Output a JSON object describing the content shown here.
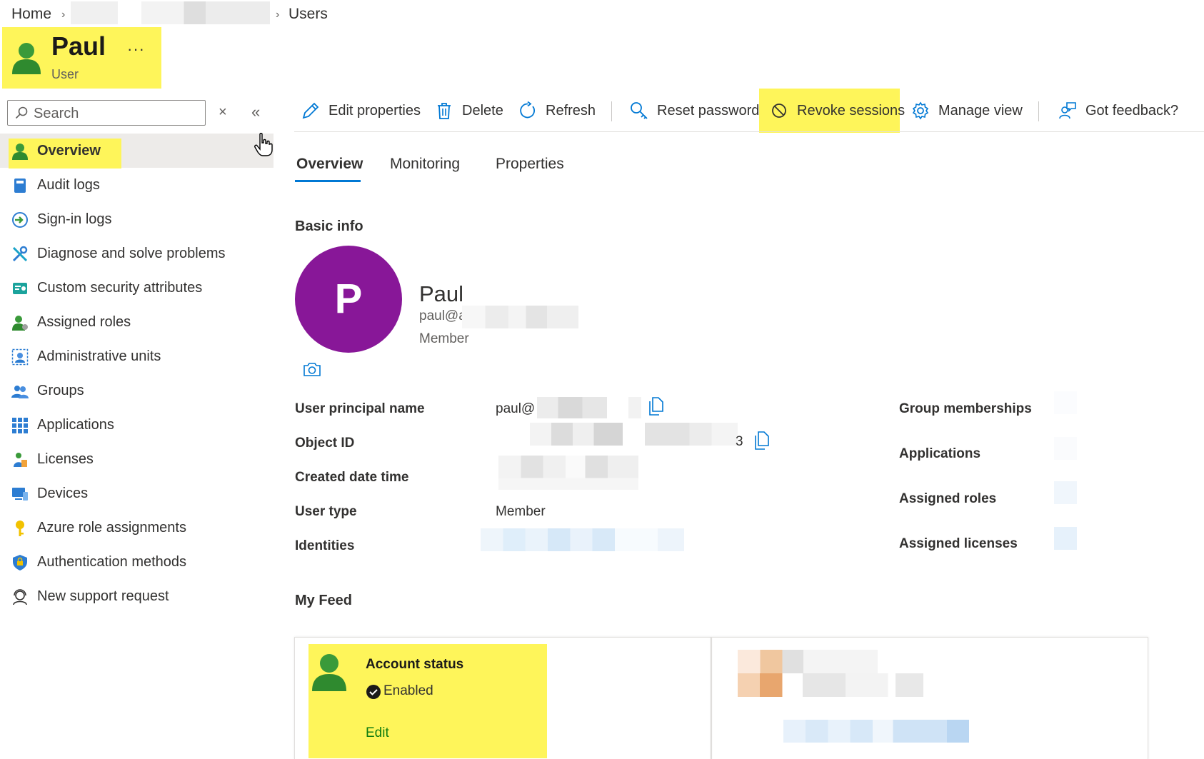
{
  "breadcrumb": {
    "home": "Home",
    "current": "Users"
  },
  "header": {
    "title": "Paul",
    "subtitle": "User",
    "more": "···"
  },
  "search": {
    "placeholder": "Search"
  },
  "sidebar": {
    "items": [
      {
        "label": "Overview",
        "icon": "user-icon"
      },
      {
        "label": "Audit logs",
        "icon": "book-icon"
      },
      {
        "label": "Sign-in logs",
        "icon": "sign-in-icon"
      },
      {
        "label": "Diagnose and solve problems",
        "icon": "wrench-icon"
      },
      {
        "label": "Custom security attributes",
        "icon": "attributes-icon"
      },
      {
        "label": "Assigned roles",
        "icon": "user-role-icon"
      },
      {
        "label": "Administrative units",
        "icon": "admin-units-icon"
      },
      {
        "label": "Groups",
        "icon": "groups-icon"
      },
      {
        "label": "Applications",
        "icon": "apps-grid-icon"
      },
      {
        "label": "Licenses",
        "icon": "license-icon"
      },
      {
        "label": "Devices",
        "icon": "devices-icon"
      },
      {
        "label": "Azure role assignments",
        "icon": "key-icon"
      },
      {
        "label": "Authentication methods",
        "icon": "shield-icon"
      },
      {
        "label": "New support request",
        "icon": "support-icon"
      }
    ]
  },
  "toolbar": {
    "edit": "Edit properties",
    "delete": "Delete",
    "refresh": "Refresh",
    "reset_password": "Reset password",
    "revoke_sessions": "Revoke sessions",
    "manage_view": "Manage view",
    "feedback": "Got feedback?"
  },
  "tabs": {
    "overview": "Overview",
    "monitoring": "Monitoring",
    "properties": "Properties"
  },
  "basic_info": {
    "heading": "Basic info",
    "avatar_letter": "P",
    "name": "Paul",
    "email": "paul@a",
    "member_type": "Member"
  },
  "properties": {
    "upn_label": "User principal name",
    "upn_value": "paul@",
    "object_id_label": "Object ID",
    "object_id_tail": "3",
    "created_label": "Created date time",
    "user_type_label": "User type",
    "user_type_value": "Member",
    "identities_label": "Identities"
  },
  "stats": {
    "group_memberships": "Group memberships",
    "applications": "Applications",
    "assigned_roles": "Assigned roles",
    "assigned_licenses": "Assigned licenses"
  },
  "feed": {
    "heading": "My Feed",
    "account_status_title": "Account status",
    "account_status_value": "Enabled",
    "edit_link": "Edit"
  },
  "colors": {
    "highlight": "#fef55a",
    "accent_blue": "#0078d4",
    "avatar_purple": "#881798",
    "user_green": "#3a9a3a",
    "link_green": "#107c10"
  }
}
